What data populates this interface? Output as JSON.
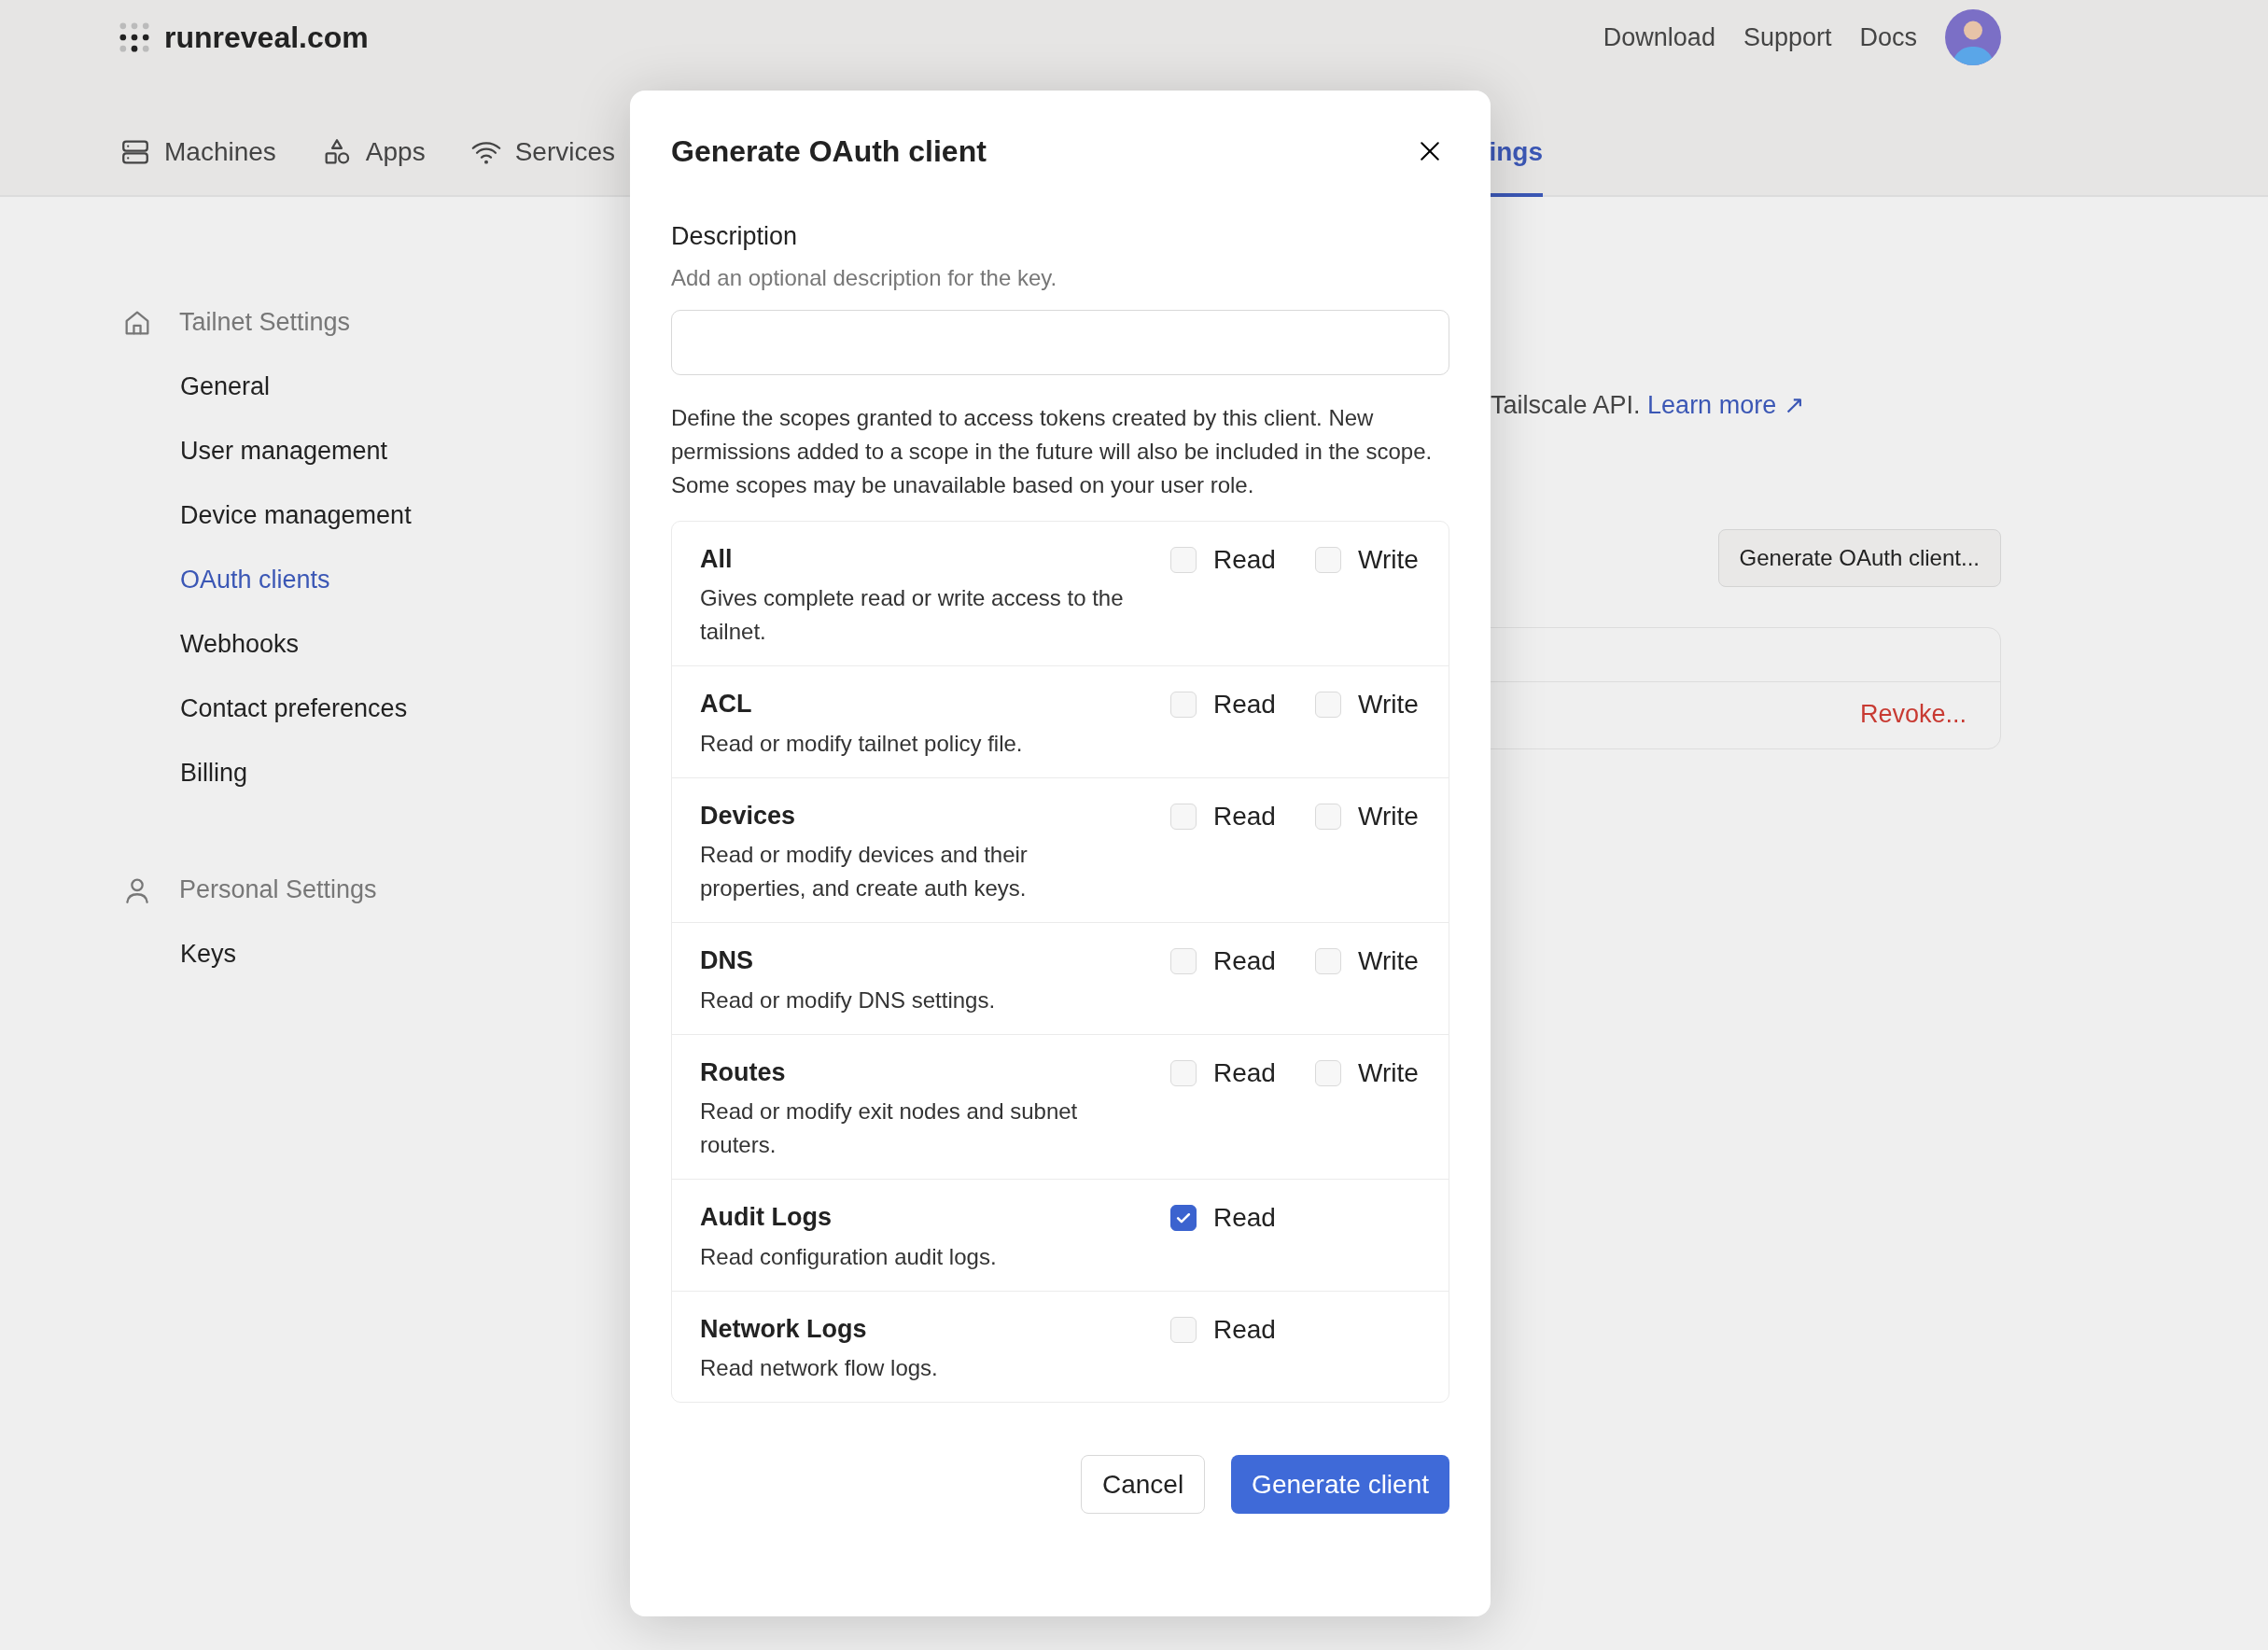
{
  "header": {
    "logo_text": "runreveal.com",
    "links": [
      {
        "label": "Download"
      },
      {
        "label": "Support"
      },
      {
        "label": "Docs"
      }
    ]
  },
  "tabs": [
    {
      "label": "Machines",
      "selected": false
    },
    {
      "label": "Apps",
      "selected": false
    },
    {
      "label": "Services",
      "selected": false
    },
    {
      "label": "ings",
      "selected": true
    }
  ],
  "sidebar": {
    "sections": [
      {
        "title": "Tailnet Settings",
        "items": [
          {
            "label": "General",
            "selected": false
          },
          {
            "label": "User management",
            "selected": false
          },
          {
            "label": "Device management",
            "selected": false
          },
          {
            "label": "OAuth clients",
            "selected": true
          },
          {
            "label": "Webhooks",
            "selected": false
          },
          {
            "label": "Contact preferences",
            "selected": false
          },
          {
            "label": "Billing",
            "selected": false
          }
        ]
      },
      {
        "title": "Personal Settings",
        "items": [
          {
            "label": "Keys",
            "selected": false
          }
        ]
      }
    ]
  },
  "page": {
    "intro_text": "Tailscale API.",
    "learn_more_link": "Learn more ↗",
    "generate_button": "Generate OAuth client...",
    "revoke_link": "Revoke..."
  },
  "dialog": {
    "title": "Generate OAuth client",
    "description_label": "Description",
    "description_hint": "Add an optional description for the key.",
    "scopes_text": "Define the scopes granted to access tokens created by this client. New permissions added to a scope in the future will also be included in the scope. Some scopes may be unavailable based on your user role.",
    "scopes": [
      {
        "name": "All",
        "description": "Gives complete read or write access to the tailnet.",
        "permissions": [
          {
            "label": "Read",
            "checked": false
          },
          {
            "label": "Write",
            "checked": false
          }
        ]
      },
      {
        "name": "ACL",
        "description": "Read or modify tailnet policy file.",
        "permissions": [
          {
            "label": "Read",
            "checked": false
          },
          {
            "label": "Write",
            "checked": false
          }
        ]
      },
      {
        "name": "Devices",
        "description": "Read or modify devices and their properties, and create auth keys.",
        "permissions": [
          {
            "label": "Read",
            "checked": false
          },
          {
            "label": "Write",
            "checked": false
          }
        ]
      },
      {
        "name": "DNS",
        "description": "Read or modify DNS settings.",
        "permissions": [
          {
            "label": "Read",
            "checked": false
          },
          {
            "label": "Write",
            "checked": false
          }
        ]
      },
      {
        "name": "Routes",
        "description": "Read or modify exit nodes and subnet routers.",
        "permissions": [
          {
            "label": "Read",
            "checked": false
          },
          {
            "label": "Write",
            "checked": false
          }
        ]
      },
      {
        "name": "Audit Logs",
        "description": "Read configuration audit logs.",
        "permissions": [
          {
            "label": "Read",
            "checked": true
          }
        ]
      },
      {
        "name": "Network Logs",
        "description": "Read network flow logs.",
        "permissions": [
          {
            "label": "Read",
            "checked": false
          }
        ]
      }
    ],
    "buttons": {
      "cancel": "Cancel",
      "submit": "Generate client"
    }
  }
}
